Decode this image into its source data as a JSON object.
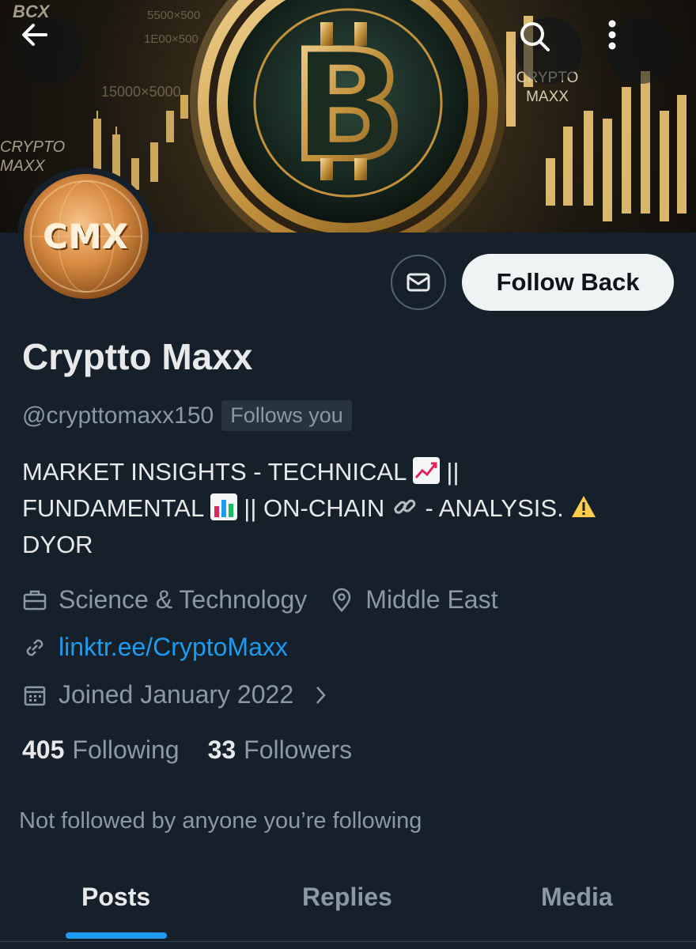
{
  "banner": {
    "brand_text": "CRYPTO MAXX",
    "icons": [
      "back-arrow-icon",
      "search-icon",
      "more-vertical-icon",
      "bitcoin-coin-icon"
    ]
  },
  "avatar": {
    "monogram": "CMX"
  },
  "actions": {
    "message_icon": "envelope-icon",
    "follow_label": "Follow Back"
  },
  "profile": {
    "display_name": "Cryptto Maxx",
    "handle": "@crypttomaxx150",
    "follows_you": "Follows you",
    "bio": {
      "part1": "MARKET INSIGHTS - TECHNICAL ",
      "part2": " ||",
      "part3": "FUNDAMENTAL ",
      "part4": " || ON-CHAIN ",
      "part5": " - ANALYSIS. ",
      "part6": "DYOR"
    },
    "category": "Science & Technology",
    "location": "Middle East",
    "website": "linktr.ee/CryptoMaxx",
    "joined": "Joined January 2022"
  },
  "stats": {
    "following_count": "405",
    "following_label": "Following",
    "followers_count": "33",
    "followers_label": "Followers"
  },
  "not_followed": "Not followed by anyone you’re following",
  "tabs": [
    {
      "label": "Posts",
      "active": true
    },
    {
      "label": "Replies",
      "active": false
    },
    {
      "label": "Media",
      "active": false
    }
  ],
  "colors": {
    "background": "#15202b",
    "accent": "#1d9bf0",
    "muted": "#8b98a5",
    "text": "#e7e9ea"
  }
}
